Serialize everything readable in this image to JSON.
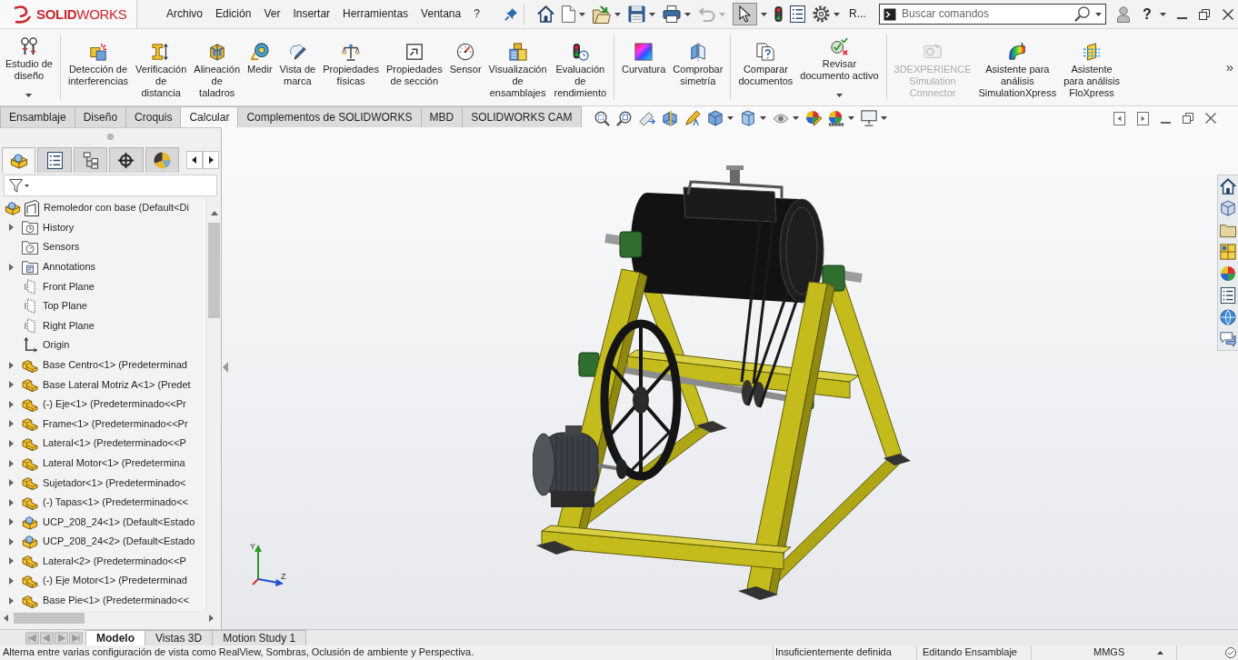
{
  "title_bar": {
    "logo": "**SOLID**WORKS",
    "menu": [
      "Archivo",
      "Edición",
      "Ver",
      "Insertar",
      "Herramientas",
      "Ventana",
      "?"
    ],
    "help": "?"
  },
  "quick_access": [
    {
      "kind": "home",
      "dropdown": false,
      "disabled": false,
      "pressed": false
    },
    {
      "kind": "new",
      "dropdown": true,
      "disabled": false,
      "pressed": false
    },
    {
      "kind": "open",
      "dropdown": true,
      "disabled": false,
      "pressed": false
    },
    {
      "kind": "save",
      "dropdown": true,
      "disabled": false,
      "pressed": false
    },
    {
      "kind": "print",
      "dropdown": true,
      "disabled": false,
      "pressed": false
    },
    {
      "kind": "undo",
      "dropdown": true,
      "disabled": true,
      "pressed": false
    },
    {
      "kind": "select",
      "dropdown": true,
      "disabled": false,
      "pressed": true
    },
    {
      "kind": "rebuild",
      "dropdown": false,
      "disabled": false,
      "pressed": false
    },
    {
      "kind": "file-properties",
      "dropdown": false,
      "disabled": false,
      "pressed": false
    },
    {
      "kind": "options",
      "dropdown": true,
      "disabled": false,
      "pressed": false
    },
    {
      "kind": "label",
      "label": "R...",
      "dropdown": false,
      "disabled": false,
      "pressed": false
    }
  ],
  "search": {
    "placeholder": "Buscar comandos"
  },
  "ribbon": {
    "groups": [
      {
        "items": [
          {
            "kind": "design-study",
            "label": "Estudio de\ndiseño",
            "dropdown": true,
            "disabled": false
          }
        ]
      },
      {
        "items": [
          {
            "kind": "interference",
            "label": "Detección de\ninterferencias",
            "dropdown": false,
            "disabled": false
          },
          {
            "kind": "clearance",
            "label": "Verificación\nde\ndistancia",
            "dropdown": false,
            "disabled": false
          },
          {
            "kind": "hole-alignment",
            "label": "Alineación\nde\ntaladros",
            "dropdown": false,
            "disabled": false
          },
          {
            "kind": "measure",
            "label": "Medir",
            "dropdown": false,
            "disabled": false
          },
          {
            "kind": "markup",
            "label": "Vista de\nmarca",
            "dropdown": false,
            "disabled": false
          },
          {
            "kind": "mass-properties",
            "label": "Propiedades\nfísicas",
            "dropdown": false,
            "disabled": false
          },
          {
            "kind": "section-properties",
            "label": "Propiedades\nde sección",
            "dropdown": false,
            "disabled": false
          },
          {
            "kind": "sensor",
            "label": "Sensor",
            "dropdown": false,
            "disabled": false
          },
          {
            "kind": "assembly-visualization",
            "label": "Visualización\nde\nensamblajes",
            "dropdown": false,
            "disabled": false
          },
          {
            "kind": "performance",
            "label": "Evaluación\nde\nrendimiento",
            "dropdown": false,
            "disabled": false
          }
        ]
      },
      {
        "items": [
          {
            "kind": "curvature",
            "label": "Curvatura",
            "dropdown": false,
            "disabled": false
          },
          {
            "kind": "symmetry",
            "label": "Comprobar\nsimetría",
            "dropdown": false,
            "disabled": false
          }
        ]
      },
      {
        "items": [
          {
            "kind": "compare",
            "label": "Comparar\ndocumentos",
            "dropdown": false,
            "disabled": false
          },
          {
            "kind": "design-checker",
            "label": "Revisar\ndocumento activo",
            "dropdown": true,
            "disabled": false
          }
        ]
      },
      {
        "items": [
          {
            "kind": "connector",
            "label": "3DEXPERIENCE\nSimulation\nConnector",
            "dropdown": false,
            "disabled": true
          },
          {
            "kind": "simulationxpress",
            "label": "Asistente para\nanálisis\nSimulationXpress",
            "dropdown": false,
            "disabled": false
          },
          {
            "kind": "floxpress",
            "label": "Asistente\npara análisis\nFloXpress",
            "dropdown": false,
            "disabled": false
          }
        ]
      }
    ],
    "overflow": "»"
  },
  "command_tabs": [
    {
      "label": "Ensamblaje",
      "selected": false
    },
    {
      "label": "Diseño",
      "selected": false
    },
    {
      "label": "Croquis",
      "selected": false
    },
    {
      "label": "Calcular",
      "selected": true
    },
    {
      "label": "Complementos de SOLIDWORKS",
      "selected": false
    },
    {
      "label": "MBD",
      "selected": false
    },
    {
      "label": "SOLIDWORKS CAM",
      "selected": false
    }
  ],
  "feature_manager": {
    "tabs": [
      {
        "kind": "feature-tree",
        "selected": true
      },
      {
        "kind": "property-manager",
        "selected": false
      },
      {
        "kind": "configuration-manager",
        "selected": false
      },
      {
        "kind": "dimxpert",
        "selected": false
      },
      {
        "kind": "display-manager",
        "selected": false
      }
    ],
    "tree": {
      "label": "Remoledor con base (Default<Di",
      "children": [
        {
          "label": "History",
          "kind": "history",
          "expandable": true
        },
        {
          "label": "Sensors",
          "kind": "sensors",
          "expandable": false
        },
        {
          "label": "Annotations",
          "kind": "annotations",
          "expandable": true
        },
        {
          "label": "Front Plane",
          "kind": "plane",
          "expandable": false
        },
        {
          "label": "Top Plane",
          "kind": "plane",
          "expandable": false
        },
        {
          "label": "Right Plane",
          "kind": "plane",
          "expandable": false
        },
        {
          "label": "Origin",
          "kind": "origin",
          "expandable": false
        },
        {
          "label": "Base Centro<1> (Predeterminad",
          "kind": "part",
          "expandable": true
        },
        {
          "label": "Base Lateral Motriz A<1> (Predet",
          "kind": "part",
          "expandable": true
        },
        {
          "label": "(-) Eje<1> (Predeterminado<<Pr",
          "kind": "part",
          "expandable": true
        },
        {
          "label": "Frame<1> (Predeterminado<<Pr",
          "kind": "part",
          "expandable": true
        },
        {
          "label": "Lateral<1> (Predeterminado<<P",
          "kind": "part",
          "expandable": true
        },
        {
          "label": "Lateral Motor<1> (Predetermina",
          "kind": "part",
          "expandable": true
        },
        {
          "label": "Sujetador<1> (Predeterminado<",
          "kind": "part",
          "expandable": true
        },
        {
          "label": "(-) Tapas<1> (Predeterminado<<",
          "kind": "part",
          "expandable": true
        },
        {
          "label": "UCP_208_24<1> (Default<Estado",
          "kind": "subassembly",
          "expandable": true
        },
        {
          "label": "UCP_208_24<2> (Default<Estado",
          "kind": "subassembly",
          "expandable": true
        },
        {
          "label": "Lateral<2> (Predeterminado<<P",
          "kind": "part",
          "expandable": true
        },
        {
          "label": "(-) Eje Motor<1> (Predeterminad",
          "kind": "part",
          "expandable": true
        },
        {
          "label": "Base Pie<1> (Predeterminado<<",
          "kind": "part",
          "expandable": true
        }
      ]
    }
  },
  "viewport": {
    "triad": [
      "Y",
      "Z"
    ]
  },
  "model_tabs": [
    {
      "label": "Modelo",
      "selected": true
    },
    {
      "label": "Vistas 3D",
      "selected": false
    },
    {
      "label": "Motion Study 1",
      "selected": false
    }
  ],
  "status_bar": {
    "message": "Alterna entre varias configuración de vista como RealView, Sombras, Oclusión de ambiente y Perspectiva.",
    "definition": "Insuficientemente definida",
    "mode": "Editando Ensamblaje",
    "units": "MMGS"
  }
}
